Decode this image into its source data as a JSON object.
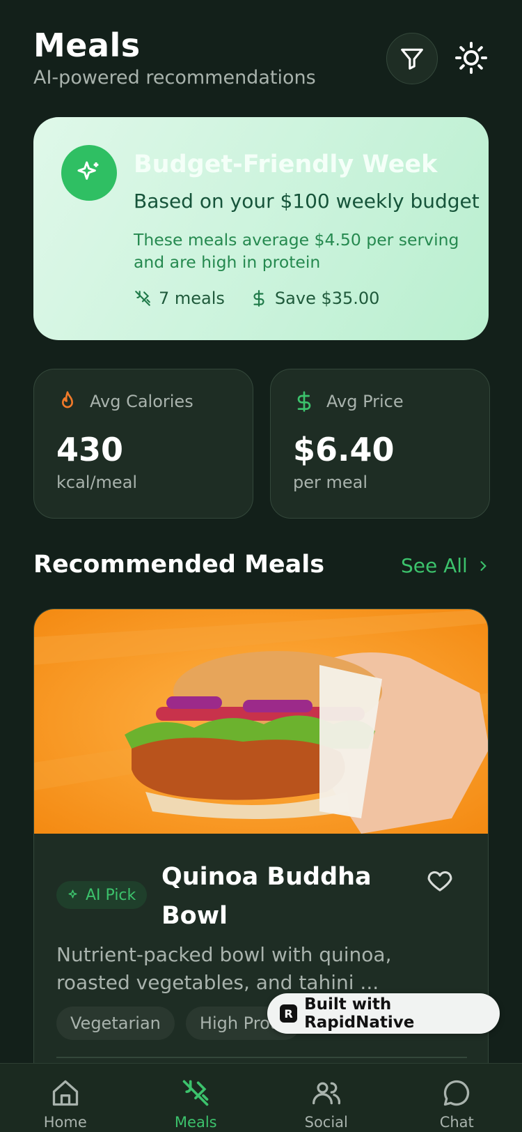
{
  "header": {
    "title": "Meals",
    "subtitle": "AI-powered recommendations",
    "filter_icon": "filter-icon",
    "theme_icon": "sun-icon"
  },
  "hero": {
    "icon": "sparkles-icon",
    "title": "Budget-Friendly Week",
    "subtitle": "Based on your $100 weekly budget",
    "description": "These meals average $4.50 per serving and are high in protein",
    "stats": [
      {
        "icon": "utensils-icon",
        "label": "7 meals"
      },
      {
        "icon": "dollar-icon",
        "label": "Save $35.00"
      }
    ]
  },
  "stats_cards": [
    {
      "icon": "flame-icon",
      "label": "Avg Calories",
      "value": "430",
      "unit": "kcal/meal"
    },
    {
      "icon": "dollar-icon",
      "label": "Avg Price",
      "value": "$6.40",
      "unit": "per meal"
    }
  ],
  "recommended": {
    "title": "Recommended Meals",
    "see_all": "See All"
  },
  "meal": {
    "badge": "AI Pick",
    "name": "Quinoa Buddha Bowl",
    "description": "Nutrient-packed bowl with quinoa, roasted vegetables, and tahini ...",
    "tags": [
      "Vegetarian",
      "High Prote"
    ]
  },
  "watermark": {
    "label": "Built with RapidNative"
  },
  "tabbar": {
    "items": [
      {
        "label": "Home",
        "icon": "home-icon",
        "active": false
      },
      {
        "label": "Meals",
        "icon": "utensils-icon",
        "active": true
      },
      {
        "label": "Social",
        "icon": "users-icon",
        "active": false
      },
      {
        "label": "Chat",
        "icon": "chat-icon",
        "active": false
      }
    ]
  },
  "colors": {
    "background": "#13201a",
    "card": "#1e2d24",
    "accent": "#3cc26c",
    "hero_bg": "#cbf3dc",
    "muted_text": "#a9b3ad"
  }
}
